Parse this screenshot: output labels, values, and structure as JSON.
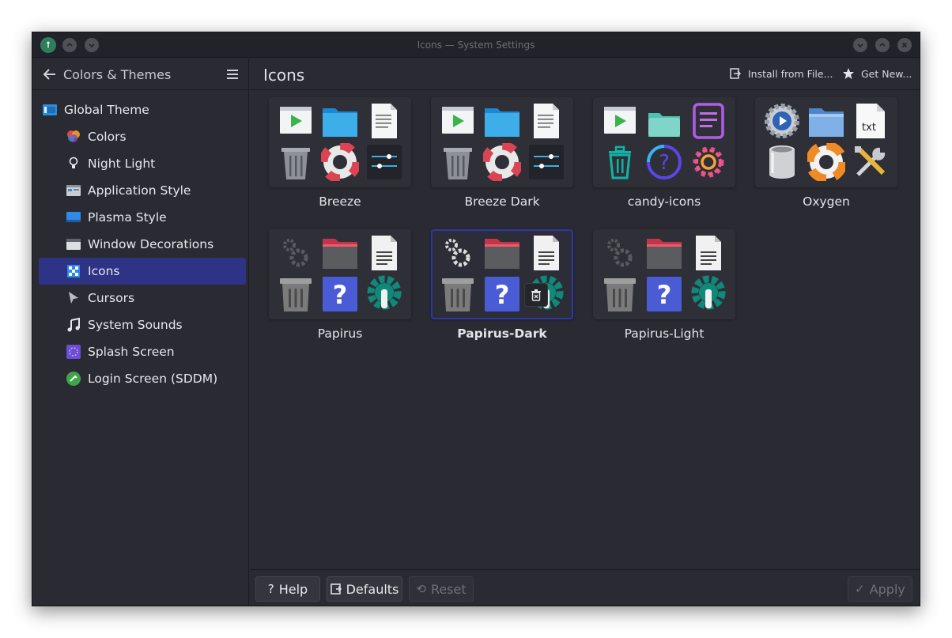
{
  "window": {
    "title": "Icons — System Settings"
  },
  "sidebar": {
    "breadcrumb": "Colors & Themes",
    "items": [
      {
        "label": "Global Theme",
        "icon": "global-theme-icon",
        "level": "top"
      },
      {
        "label": "Colors",
        "icon": "colors-icon",
        "level": "sub"
      },
      {
        "label": "Night Light",
        "icon": "lightbulb-icon",
        "level": "sub"
      },
      {
        "label": "Application Style",
        "icon": "application-style-icon",
        "level": "sub"
      },
      {
        "label": "Plasma Style",
        "icon": "plasma-style-icon",
        "level": "sub"
      },
      {
        "label": "Window Decorations",
        "icon": "window-decorations-icon",
        "level": "sub"
      },
      {
        "label": "Icons",
        "icon": "icons-icon",
        "level": "sub",
        "active": true
      },
      {
        "label": "Cursors",
        "icon": "cursor-icon",
        "level": "sub"
      },
      {
        "label": "System Sounds",
        "icon": "music-note-icon",
        "level": "sub"
      },
      {
        "label": "Splash Screen",
        "icon": "splash-screen-icon",
        "level": "sub"
      },
      {
        "label": "Login Screen (SDDM)",
        "icon": "login-screen-icon",
        "level": "sub"
      }
    ]
  },
  "main": {
    "title": "Icons",
    "install_label": "Install from File...",
    "get_new_label": "Get New...",
    "themes": [
      {
        "name": "Breeze",
        "selected": false
      },
      {
        "name": "Breeze Dark",
        "selected": false
      },
      {
        "name": "candy-icons",
        "selected": false
      },
      {
        "name": "Oxygen",
        "selected": false
      },
      {
        "name": "Papirus",
        "selected": false
      },
      {
        "name": "Papirus-Dark",
        "selected": true
      },
      {
        "name": "Papirus-Light",
        "selected": false
      }
    ]
  },
  "footer": {
    "help": "Help",
    "defaults": "Defaults",
    "reset": "Reset",
    "apply": "Apply"
  },
  "colors": {
    "accent": "#2f3386",
    "selection_border": "#2f36a8",
    "window_bg": "#2a2b32"
  }
}
